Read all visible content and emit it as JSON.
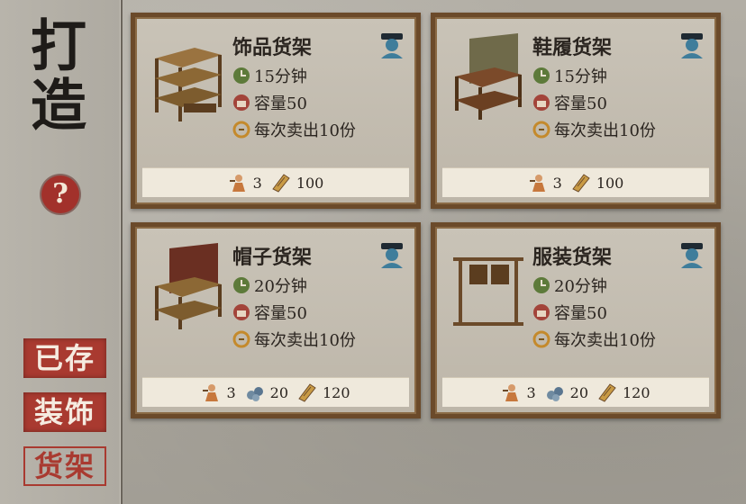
{
  "sidebar": {
    "title": "打造",
    "help_label": "?",
    "nav": [
      {
        "label": "已存",
        "active": false
      },
      {
        "label": "装饰",
        "active": false
      },
      {
        "label": "货架",
        "active": true
      }
    ]
  },
  "cards": [
    {
      "name": "饰品货架",
      "time": "15分钟",
      "capacity": "容量50",
      "sell": "每次卖出10份",
      "cost": [
        {
          "icon": "worker-icon",
          "value": "3"
        },
        {
          "icon": "wood-plank-icon",
          "value": "100"
        }
      ]
    },
    {
      "name": "鞋履货架",
      "time": "15分钟",
      "capacity": "容量50",
      "sell": "每次卖出10份",
      "cost": [
        {
          "icon": "worker-icon",
          "value": "3"
        },
        {
          "icon": "wood-plank-icon",
          "value": "100"
        }
      ]
    },
    {
      "name": "帽子货架",
      "time": "20分钟",
      "capacity": "容量50",
      "sell": "每次卖出10份",
      "cost": [
        {
          "icon": "worker-icon",
          "value": "3"
        },
        {
          "icon": "stone-icon",
          "value": "20"
        },
        {
          "icon": "wood-plank-icon",
          "value": "120"
        }
      ]
    },
    {
      "name": "服装货架",
      "time": "20分钟",
      "capacity": "容量50",
      "sell": "每次卖出10份",
      "cost": [
        {
          "icon": "worker-icon",
          "value": "3"
        },
        {
          "icon": "stone-icon",
          "value": "20"
        },
        {
          "icon": "wood-plank-icon",
          "value": "120"
        }
      ]
    }
  ],
  "colors": {
    "accent_red": "#a93a30",
    "card_frame": "#6b4a2a",
    "badge_blue": "#3f7d9b"
  }
}
